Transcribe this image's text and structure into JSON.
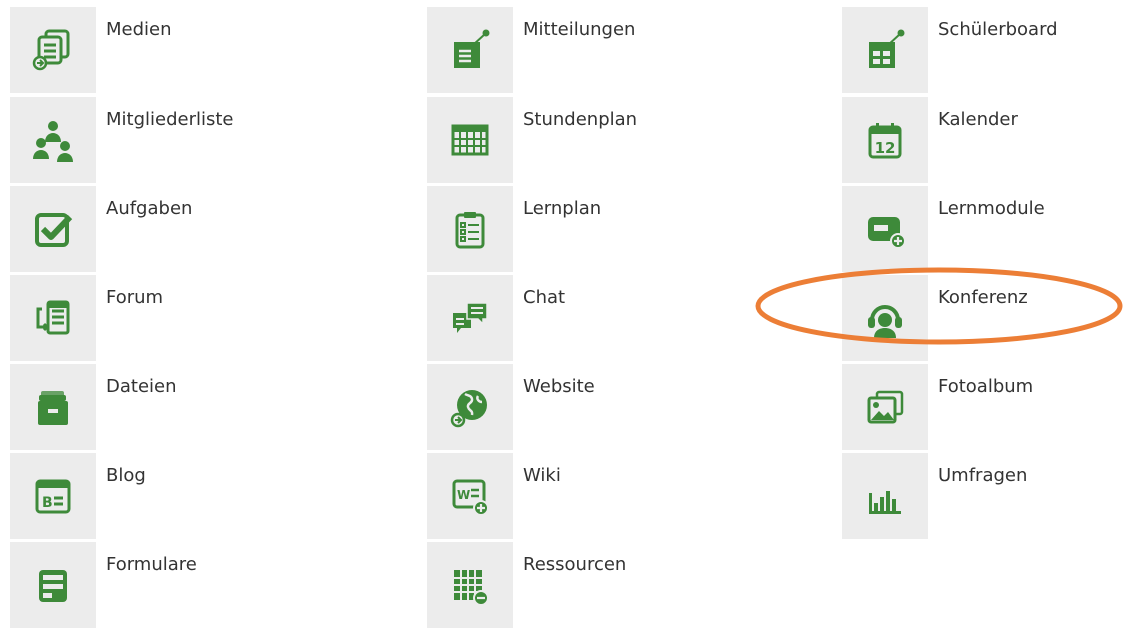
{
  "colors": {
    "icon_green": "#3e8a3a",
    "tile_bg": "#ececec",
    "highlight": "#ec7e36",
    "label_text": "#333333"
  },
  "modules": [
    {
      "label": "Medien",
      "icon": "media-icon"
    },
    {
      "label": "Mitteilungen",
      "icon": "message-pin-icon"
    },
    {
      "label": "Schülerboard",
      "icon": "board-pin-icon"
    },
    {
      "label": "Mitgliederliste",
      "icon": "members-icon"
    },
    {
      "label": "Stundenplan",
      "icon": "timetable-icon"
    },
    {
      "label": "Kalender",
      "icon": "calendar-icon"
    },
    {
      "label": "Aufgaben",
      "icon": "checkbox-icon"
    },
    {
      "label": "Lernplan",
      "icon": "clipboard-list-icon"
    },
    {
      "label": "Lernmodule",
      "icon": "learning-module-icon"
    },
    {
      "label": "Forum",
      "icon": "forum-icon"
    },
    {
      "label": "Chat",
      "icon": "chat-icon"
    },
    {
      "label": "Konferenz",
      "icon": "headset-icon"
    },
    {
      "label": "Dateien",
      "icon": "files-icon"
    },
    {
      "label": "Website",
      "icon": "globe-icon"
    },
    {
      "label": "Fotoalbum",
      "icon": "photo-album-icon"
    },
    {
      "label": "Blog",
      "icon": "blog-icon"
    },
    {
      "label": "Wiki",
      "icon": "wiki-icon"
    },
    {
      "label": "Umfragen",
      "icon": "bar-chart-icon"
    },
    {
      "label": "Formulare",
      "icon": "form-icon"
    },
    {
      "label": "Ressourcen",
      "icon": "resources-icon"
    }
  ],
  "calendar_icon_day": "12",
  "blog_icon_text": "B",
  "wiki_icon_text": "W"
}
